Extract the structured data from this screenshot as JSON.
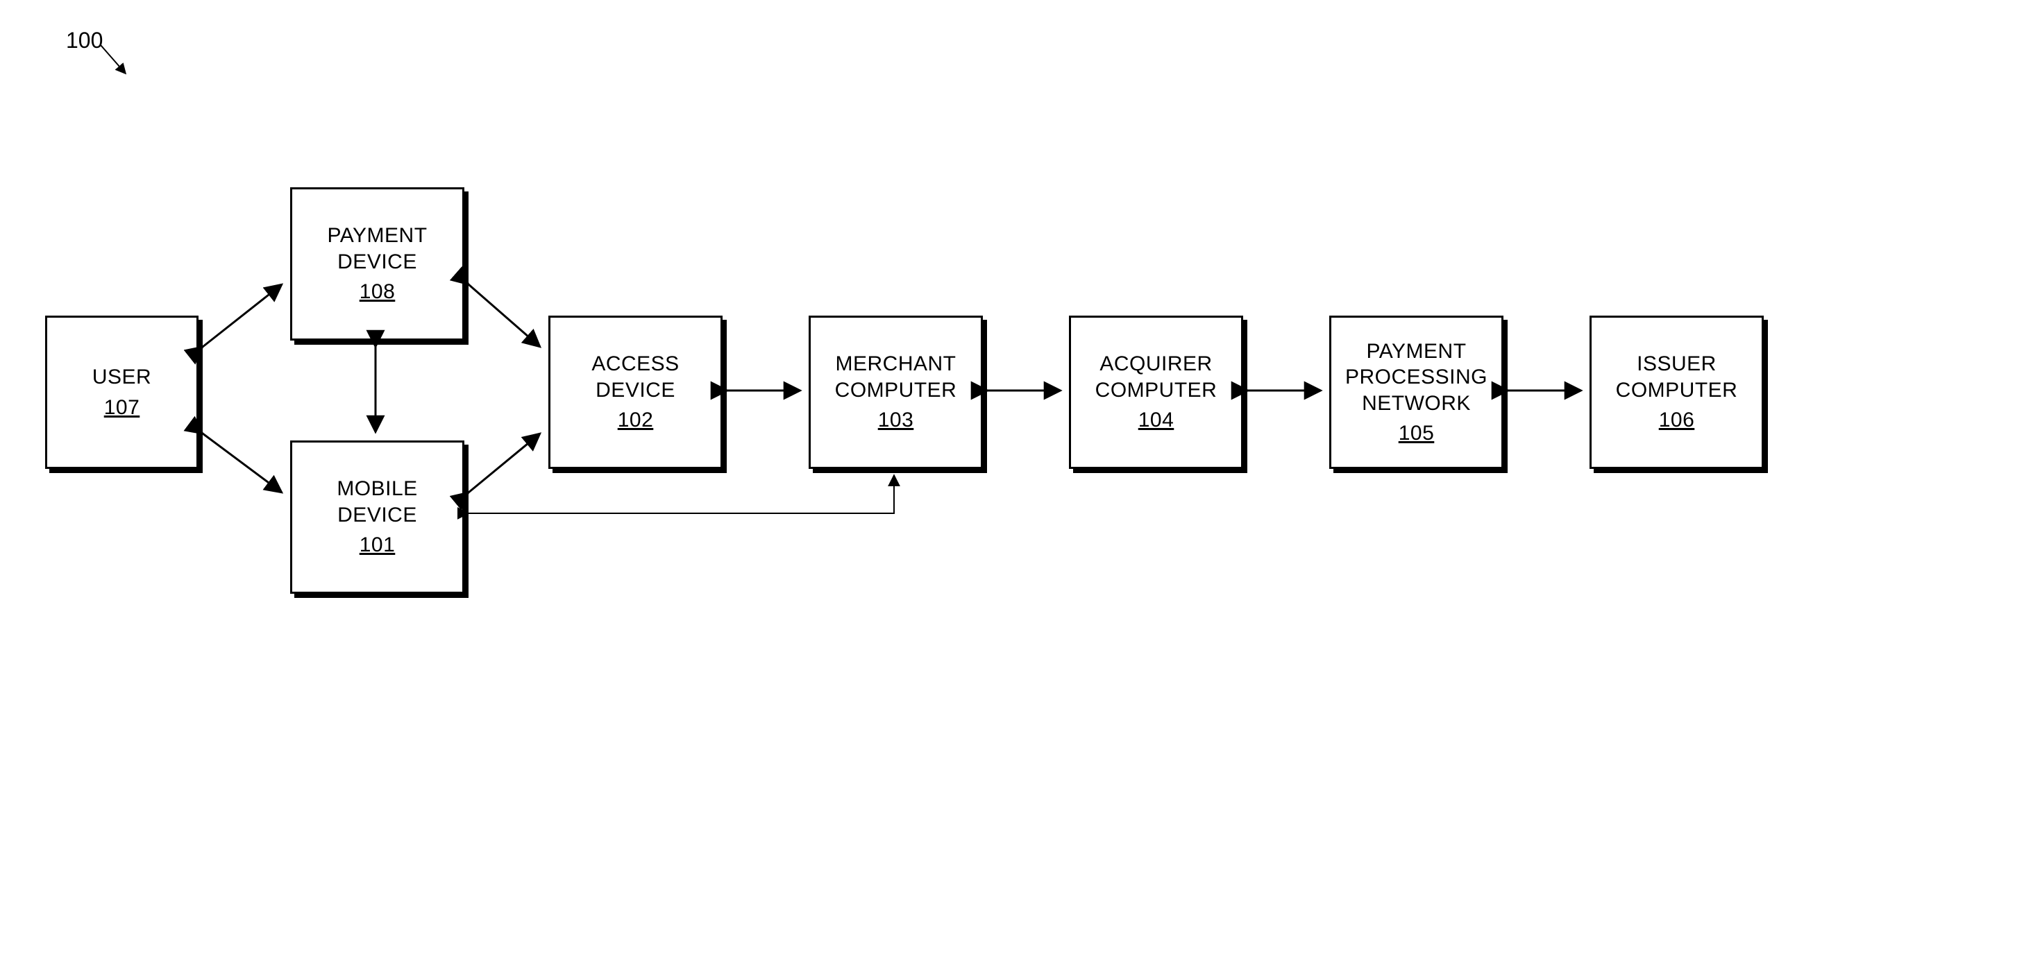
{
  "figure": {
    "label": "100"
  },
  "nodes": {
    "user": {
      "title": "USER",
      "ref": "107"
    },
    "payment_device": {
      "title": "PAYMENT\nDEVICE",
      "ref": "108"
    },
    "mobile_device": {
      "title": "MOBILE\nDEVICE",
      "ref": "101"
    },
    "access_device": {
      "title": "ACCESS\nDEVICE",
      "ref": "102"
    },
    "merchant": {
      "title": "MERCHANT\nCOMPUTER",
      "ref": "103"
    },
    "acquirer": {
      "title": "ACQUIRER\nCOMPUTER",
      "ref": "104"
    },
    "ppn": {
      "title": "PAYMENT\nPROCESSING\nNETWORK",
      "ref": "105"
    },
    "issuer": {
      "title": "ISSUER\nCOMPUTER",
      "ref": "106"
    }
  }
}
